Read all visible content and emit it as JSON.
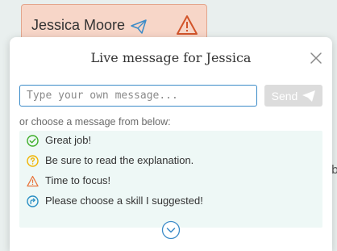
{
  "student_card": {
    "name": "Jessica Moore",
    "send_icon": "paper-plane-icon",
    "status_icon": "warning-triangle-icon"
  },
  "modal": {
    "title": "Live message for Jessica",
    "close_icon": "close-icon",
    "input": {
      "placeholder": "Type your own message...",
      "value": ""
    },
    "send_label": "Send",
    "send_icon": "paper-plane-icon",
    "choose_label": "or choose a message from below:",
    "messages": [
      {
        "text": "Great job!",
        "icon": "check-circle-icon",
        "color": "#3fae29"
      },
      {
        "text": "Be sure to read the explanation.",
        "icon": "question-circle-icon",
        "color": "#f0b400"
      },
      {
        "text": "Time to focus!",
        "icon": "warning-triangle-icon",
        "color": "#e8743b"
      },
      {
        "text": "Please choose a skill I suggested!",
        "icon": "redirect-circle-icon",
        "color": "#2a8fc4"
      }
    ],
    "more_icon": "chevron-down-circle-icon"
  },
  "colors": {
    "accent": "#3b8bc8",
    "card_background": "#f7d6c8",
    "card_border": "#e3a58c",
    "list_background": "#eef8f6"
  }
}
